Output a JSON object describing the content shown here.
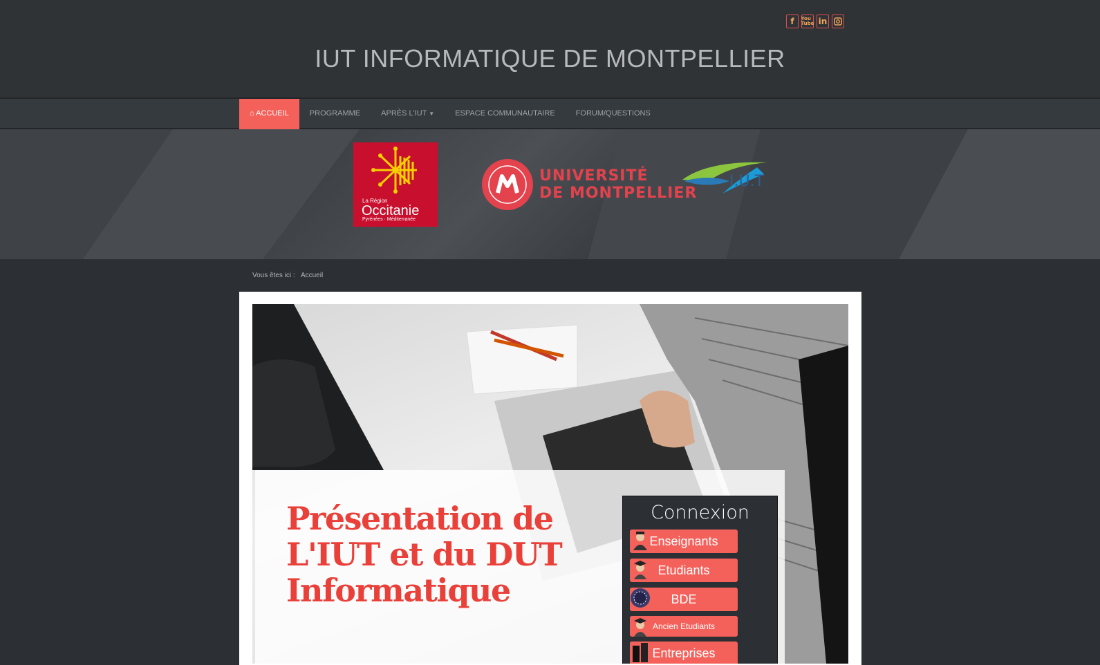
{
  "header": {
    "title": "IUT INFORMATIQUE DE MONTPELLIER",
    "social": [
      "facebook-icon",
      "youtube-icon",
      "linkedin-icon",
      "instagram-icon"
    ]
  },
  "nav": {
    "items": [
      {
        "label": "ACCUEIL",
        "active": true
      },
      {
        "label": "PROGRAMME"
      },
      {
        "label": "APRÈS L'IUT",
        "dropdown": true
      },
      {
        "label": "ESPACE COMMUNAUTAIRE"
      },
      {
        "label": "FORUM/QUESTIONS"
      }
    ]
  },
  "logos": {
    "occitanie": {
      "small": "La Région",
      "big": "Occitanie",
      "sub": "Pyrénées · Méditerranée"
    },
    "um": {
      "line1": "UNIVERSITÉ",
      "line2": "DE MONTPELLIER"
    },
    "iut": {
      "text": "I.U.T"
    }
  },
  "breadcrumb": {
    "prefix": "Vous êtes ici :",
    "current": "Accueil"
  },
  "hero": {
    "title": "Présentation de L'IUT et du DUT Informatique"
  },
  "login": {
    "title": "Connexion",
    "buttons": [
      "Enseignants",
      "Etudiants",
      "BDE",
      "Ancien Etudiants",
      "Entreprises"
    ]
  },
  "colors": {
    "accent": "#f4615b",
    "title_red": "#e9413a",
    "background": "#2c3034"
  }
}
